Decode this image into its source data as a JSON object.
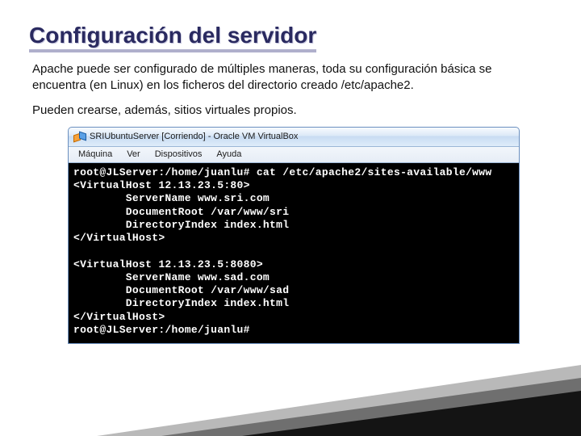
{
  "title": "Configuración del servidor",
  "paragraph1": "Apache puede ser configurado de múltiples maneras, toda su configuración básica se encuentra (en Linux) en los ficheros del directorio creado /etc/apache2.",
  "paragraph2": "Pueden crearse, además, sitios virtuales propios.",
  "vm": {
    "window_title": "SRIUbuntuServer [Corriendo] - Oracle VM VirtualBox",
    "menu": {
      "maquina": "Máquina",
      "ver": "Ver",
      "dispositivos": "Dispositivos",
      "ayuda": "Ayuda"
    },
    "terminal_lines": [
      "root@JLServer:/home/juanlu# cat /etc/apache2/sites-available/www",
      "<VirtualHost 12.13.23.5:80>",
      "        ServerName www.sri.com",
      "        DocumentRoot /var/www/sri",
      "        DirectoryIndex index.html",
      "</VirtualHost>",
      "",
      "<VirtualHost 12.13.23.5:8080>",
      "        ServerName www.sad.com",
      "        DocumentRoot /var/www/sad",
      "        DirectoryIndex index.html",
      "</VirtualHost>",
      "root@JLServer:/home/juanlu#"
    ]
  }
}
